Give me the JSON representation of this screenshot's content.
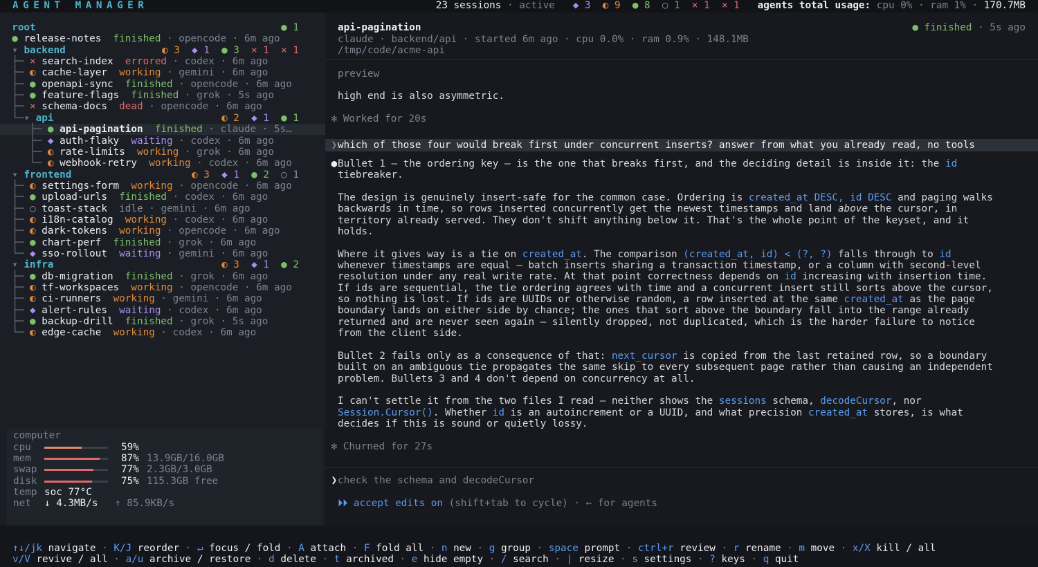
{
  "app": {
    "title": "AGENT MANAGER"
  },
  "topbar": {
    "sessions": "23 sessions",
    "active": "active",
    "badges": [
      "◆ 3",
      "◐ 9",
      "● 8",
      "○ 1",
      "× 1",
      "× 1"
    ],
    "usage_label": "agents total usage:",
    "cpu": "cpu 0%",
    "ram": "ram 1%",
    "mem": "170.7MB"
  },
  "colors": {
    "accent": "#4fb3c9",
    "finished": "#7fbf6a",
    "working": "#e08a3c",
    "waiting": "#a88ef0",
    "errored": "#e06a6a"
  },
  "tree": [
    {
      "kind": "group",
      "indent": "",
      "name": "root",
      "counts": "● 1"
    },
    {
      "kind": "item",
      "indent": "",
      "icon": "●",
      "icolor": "green",
      "name": "release-notes",
      "status": "finished",
      "scolor": "green",
      "agent": "opencode",
      "ago": "6m ago"
    },
    {
      "kind": "group",
      "indent": "▾ ",
      "name": "backend",
      "counts": "◐ 3  ◆ 1  ● 3  × 1  × 1"
    },
    {
      "kind": "item",
      "indent": "├─ ",
      "icon": "×",
      "icolor": "red",
      "name": "search-index",
      "status": "errored",
      "scolor": "red",
      "agent": "codex",
      "ago": "6m ago"
    },
    {
      "kind": "item",
      "indent": "├─ ",
      "icon": "◐",
      "icolor": "orange",
      "name": "cache-layer",
      "status": "working",
      "scolor": "orange",
      "agent": "gemini",
      "ago": "6m ago"
    },
    {
      "kind": "item",
      "indent": "├─ ",
      "icon": "●",
      "icolor": "green",
      "name": "openapi-sync",
      "status": "finished",
      "scolor": "green",
      "agent": "opencode",
      "ago": "6m ago"
    },
    {
      "kind": "item",
      "indent": "├─ ",
      "icon": "●",
      "icolor": "green",
      "name": "feature-flags",
      "status": "finished",
      "scolor": "green",
      "agent": "grok",
      "ago": "5s ago"
    },
    {
      "kind": "item",
      "indent": "├─ ",
      "icon": "×",
      "icolor": "red",
      "name": "schema-docs",
      "status": "dead",
      "scolor": "red",
      "agent": "opencode",
      "ago": "6m ago"
    },
    {
      "kind": "group",
      "indent": "└─▾ ",
      "name": "api",
      "counts": "◐ 2  ◆ 1  ● 1"
    },
    {
      "kind": "item",
      "indent": "   ├─ ",
      "icon": "●",
      "icolor": "green",
      "name": "api-pagination",
      "status": "finished",
      "scolor": "green",
      "agent": "claude",
      "ago": "5s…",
      "selected": true
    },
    {
      "kind": "item",
      "indent": "   ├─ ",
      "icon": "◆",
      "icolor": "purple",
      "name": "auth-flaky",
      "status": "waiting",
      "scolor": "purple",
      "agent": "codex",
      "ago": "6m ago"
    },
    {
      "kind": "item",
      "indent": "   ├─ ",
      "icon": "◐",
      "icolor": "orange",
      "name": "rate-limits",
      "status": "working",
      "scolor": "orange",
      "agent": "grok",
      "ago": "6m ago"
    },
    {
      "kind": "item",
      "indent": "   └─ ",
      "icon": "◐",
      "icolor": "orange",
      "name": "webhook-retry",
      "status": "working",
      "scolor": "orange",
      "agent": "codex",
      "ago": "6m ago"
    },
    {
      "kind": "group",
      "indent": "▾ ",
      "name": "frontend",
      "counts": "◐ 3  ◆ 1  ● 2  ○ 1"
    },
    {
      "kind": "item",
      "indent": "├─ ",
      "icon": "◐",
      "icolor": "orange",
      "name": "settings-form",
      "status": "working",
      "scolor": "orange",
      "agent": "opencode",
      "ago": "6m ago"
    },
    {
      "kind": "item",
      "indent": "├─ ",
      "icon": "●",
      "icolor": "green",
      "name": "upload-urls",
      "status": "finished",
      "scolor": "green",
      "agent": "codex",
      "ago": "6m ago"
    },
    {
      "kind": "item",
      "indent": "├─ ",
      "icon": "○",
      "icolor": "gray",
      "name": "toast-stack",
      "status": "idle",
      "scolor": "gray",
      "agent": "gemini",
      "ago": "6m ago"
    },
    {
      "kind": "item",
      "indent": "├─ ",
      "icon": "◐",
      "icolor": "orange",
      "name": "i18n-catalog",
      "status": "working",
      "scolor": "orange",
      "agent": "codex",
      "ago": "6m ago"
    },
    {
      "kind": "item",
      "indent": "├─ ",
      "icon": "◐",
      "icolor": "orange",
      "name": "dark-tokens",
      "status": "working",
      "scolor": "orange",
      "agent": "opencode",
      "ago": "6m ago"
    },
    {
      "kind": "item",
      "indent": "├─ ",
      "icon": "●",
      "icolor": "green",
      "name": "chart-perf",
      "status": "finished",
      "scolor": "green",
      "agent": "grok",
      "ago": "6m ago"
    },
    {
      "kind": "item",
      "indent": "└─ ",
      "icon": "◆",
      "icolor": "purple",
      "name": "sso-rollout",
      "status": "waiting",
      "scolor": "purple",
      "agent": "gemini",
      "ago": "6m ago"
    },
    {
      "kind": "group",
      "indent": "▾ ",
      "name": "infra",
      "counts": "◐ 3  ◆ 1  ● 2"
    },
    {
      "kind": "item",
      "indent": "├─ ",
      "icon": "●",
      "icolor": "green",
      "name": "db-migration",
      "status": "finished",
      "scolor": "green",
      "agent": "grok",
      "ago": "6m ago"
    },
    {
      "kind": "item",
      "indent": "├─ ",
      "icon": "◐",
      "icolor": "orange",
      "name": "tf-workspaces",
      "status": "working",
      "scolor": "orange",
      "agent": "opencode",
      "ago": "6m ago"
    },
    {
      "kind": "item",
      "indent": "├─ ",
      "icon": "◐",
      "icolor": "orange",
      "name": "ci-runners",
      "status": "working",
      "scolor": "orange",
      "agent": "gemini",
      "ago": "6m ago"
    },
    {
      "kind": "item",
      "indent": "├─ ",
      "icon": "◆",
      "icolor": "purple",
      "name": "alert-rules",
      "status": "waiting",
      "scolor": "purple",
      "agent": "codex",
      "ago": "6m ago"
    },
    {
      "kind": "item",
      "indent": "├─ ",
      "icon": "●",
      "icolor": "green",
      "name": "backup-drill",
      "status": "finished",
      "scolor": "green",
      "agent": "grok",
      "ago": "5s ago"
    },
    {
      "kind": "item",
      "indent": "└─ ",
      "icon": "◐",
      "icolor": "orange",
      "name": "edge-cache",
      "status": "working",
      "scolor": "orange",
      "agent": "codex",
      "ago": "6m ago"
    }
  ],
  "system": {
    "heading": "computer",
    "cpu": {
      "label": "cpu",
      "pct": "59%",
      "frac": 0.59,
      "extra": ""
    },
    "mem": {
      "label": "mem",
      "pct": "87%",
      "frac": 0.87,
      "extra": "13.9GB/16.0GB"
    },
    "swap": {
      "label": "swap",
      "pct": "77%",
      "frac": 0.77,
      "extra": "2.3GB/3.0GB"
    },
    "disk": {
      "label": "disk",
      "pct": "75%",
      "frac": 0.75,
      "extra": "115.3GB free"
    },
    "temp": {
      "label": "temp",
      "value": "soc 77°C"
    },
    "net": {
      "label": "net",
      "down": "↓ 4.3MB/s",
      "up": "↑ 85.9KB/s"
    }
  },
  "session": {
    "title": "api-pagination",
    "meta": "claude · backend/api · started 6m ago · cpu 0.0% · ram 0.9% · 148.1MB",
    "path": "/tmp/code/acme-api",
    "status_icon": "●",
    "status": "finished",
    "status_ago": "· 5s ago",
    "preview_label": "preview"
  },
  "transcript": {
    "line1": "high end is also asymmetric.",
    "worked": "Worked for 20s",
    "prompt": "which of those four would break first under concurrent inserts? answer from what you already read, no tools",
    "churned": "Churned for 27s"
  },
  "input": {
    "value": "check the schema and decodeCursor"
  },
  "mode": {
    "arrows": "⏵⏵",
    "label": "accept edits on",
    "hint": "(shift+tab to cycle) · ← for agents"
  },
  "help": {
    "line1": [
      [
        "↑↓/jk",
        "navigate"
      ],
      [
        "K/J",
        "reorder"
      ],
      [
        "↵",
        "focus / fold"
      ],
      [
        "A",
        "attach"
      ],
      [
        "F",
        "fold all"
      ],
      [
        "n",
        "new"
      ],
      [
        "g",
        "group"
      ],
      [
        "space",
        "prompt"
      ],
      [
        "ctrl+r",
        "review"
      ],
      [
        "r",
        "rename"
      ],
      [
        "m",
        "move"
      ],
      [
        "x/X",
        "kill / all"
      ]
    ],
    "line2": [
      [
        "v/V",
        "revive / all"
      ],
      [
        "a/u",
        "archive / restore"
      ],
      [
        "d",
        "delete"
      ],
      [
        "t",
        "archived"
      ],
      [
        "e",
        "hide empty"
      ],
      [
        "/",
        "search"
      ],
      [
        "|",
        "resize"
      ],
      [
        "s",
        "settings"
      ],
      [
        "?",
        "keys"
      ],
      [
        "q",
        "quit"
      ]
    ]
  }
}
